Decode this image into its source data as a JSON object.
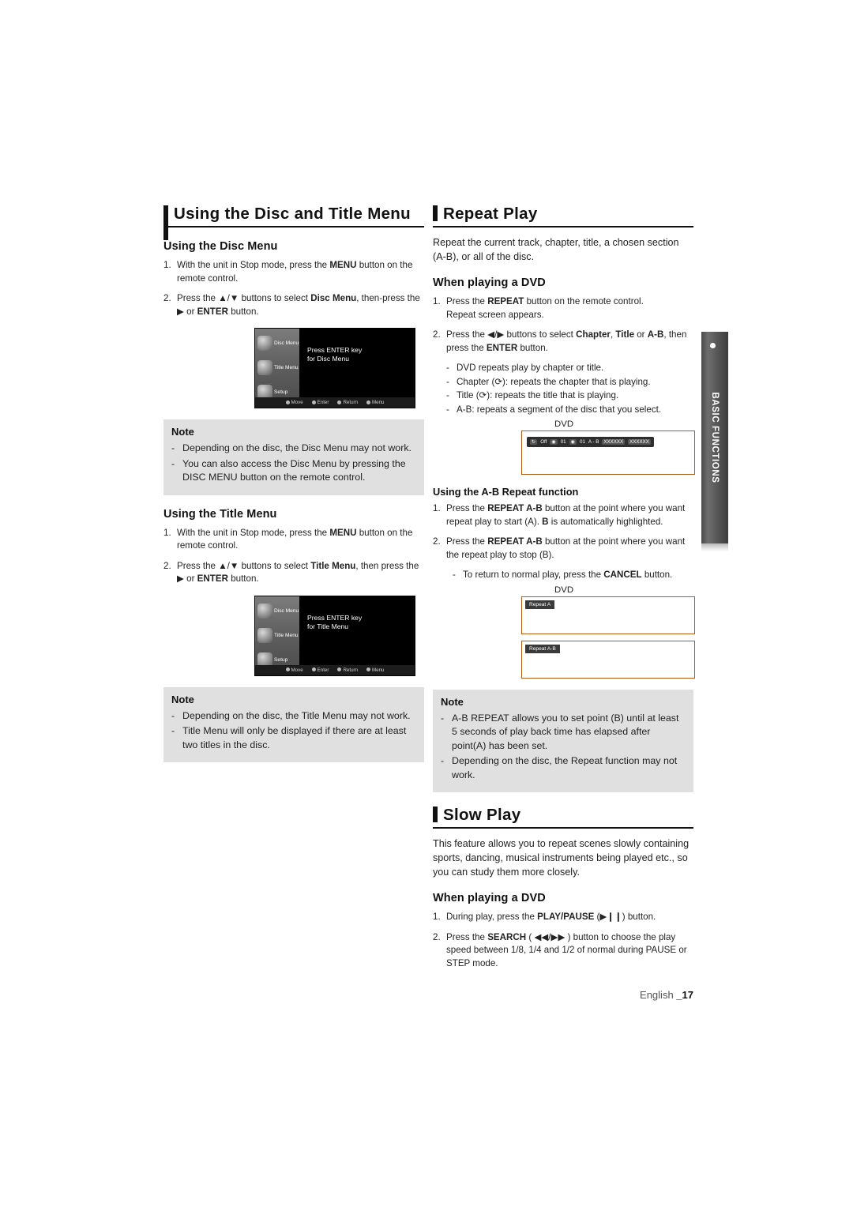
{
  "left": {
    "title": "Using the Disc and Title Menu",
    "disc_menu": {
      "heading": "Using the Disc Menu",
      "steps": [
        {
          "num": "1.",
          "text_a": "With the unit in Stop mode, press the ",
          "bold": "MENU",
          "text_b": " button on the remote control."
        },
        {
          "num": "2.",
          "text_a": "Press the ▲/▼ buttons to select ",
          "bold": "Disc Menu",
          "text_b": ", then-press the ▶ or ",
          "bold2": "ENTER",
          "text_c": " button."
        }
      ],
      "screen": {
        "items": [
          {
            "label": "Disc Menu"
          },
          {
            "label": "Title Menu"
          },
          {
            "label": "Setup"
          }
        ],
        "main_line1": "Press ENTER key",
        "main_line2": "for Disc Menu",
        "foot": [
          "Move",
          "Enter",
          "Return",
          "Menu"
        ]
      },
      "note": {
        "title": "Note",
        "items": [
          "Depending on the disc, the Disc Menu may not work.",
          "You can also access the Disc Menu by pressing the DISC MENU button on the remote control."
        ]
      }
    },
    "title_menu": {
      "heading": "Using the Title Menu",
      "steps": [
        {
          "num": "1.",
          "text_a": "With the unit in Stop mode, press the ",
          "bold": "MENU",
          "text_b": " button on the remote control."
        },
        {
          "num": "2.",
          "text_a": "Press the ▲/▼ buttons to select ",
          "bold": "Title Menu",
          "text_b": ", then press the ▶ or ",
          "bold2": "ENTER",
          "text_c": " button."
        }
      ],
      "screen": {
        "items": [
          {
            "label": "Disc Menu"
          },
          {
            "label": "Title Menu"
          },
          {
            "label": "Setup"
          }
        ],
        "main_line1": "Press ENTER key",
        "main_line2": "for Title Menu",
        "foot": [
          "Move",
          "Enter",
          "Return",
          "Menu"
        ]
      },
      "note": {
        "title": "Note",
        "items": [
          "Depending on the disc, the Title Menu may not work.",
          "Title Menu will only be displayed if there are at least two titles in the disc."
        ]
      }
    }
  },
  "right": {
    "repeat": {
      "title": "Repeat Play",
      "intro": "Repeat the current track, chapter, title, a chosen section (A-B), or all of the disc.",
      "dvd_heading": "When playing a DVD",
      "step1_a": "Press the ",
      "step1_bold": "REPEAT",
      "step1_b": " button on the remote control.",
      "step1_sub": "Repeat screen appears.",
      "step2_a": "Press the ◀/▶ buttons to select ",
      "step2_bold1": "Chapter",
      "step2_mid1": ", ",
      "step2_bold2": "Title",
      "step2_mid2": " or ",
      "step2_bold3": "A-B",
      "step2_b": ", then press the ",
      "step2_bold4": "ENTER",
      "step2_c": " button.",
      "bullets": [
        "DVD repeats play by chapter or title.",
        "Chapter (⟳): repeats the chapter that is playing.",
        "Title (⟳): repeats the title that is playing.",
        "A-B: repeats a segment of the disc that you select."
      ],
      "osd_label": "DVD",
      "osd_items": [
        "Off",
        "01",
        "01",
        "A - B",
        "XXXXXX",
        "XXXXXX"
      ],
      "ab": {
        "heading": "Using the A-B Repeat function",
        "step1_a": "Press the ",
        "step1_bold": "REPEAT A-B",
        "step1_b": " button at the point where you want repeat play to start (A). ",
        "step1_bold2": "B",
        "step1_c": " is automatically highlighted.",
        "step2_a": "Press the ",
        "step2_bold": "REPEAT A-B",
        "step2_b": " button at the point where you want the repeat play to stop (B).",
        "dash_a": "To return to normal play, press the ",
        "dash_bold": "CANCEL",
        "dash_b": " button.",
        "dvd_label": "DVD",
        "tag1": "Repeat A",
        "tag2": "Repeat A-B"
      },
      "note": {
        "title": "Note",
        "items": [
          "A-B REPEAT allows you to set point (B) until at least 5 seconds of play back time has elapsed after point(A) has been set.",
          "Depending on the disc, the Repeat function may not work."
        ]
      }
    },
    "slow": {
      "title": "Slow Play",
      "intro": "This feature allows you  to repeat scenes slowly containing sports, dancing, musical instruments being played etc., so you can study them more closely.",
      "dvd_heading": "When playing a DVD",
      "step1_a": "During play, press the ",
      "step1_bold": "PLAY/PAUSE",
      "step1_b": " (▶❙❙) button.",
      "step2_a": "Press the ",
      "step2_bold": "SEARCH",
      "step2_b": " ( ◀◀/▶▶ ) button to choose the play speed between 1/8, 1/4 and 1/2 of normal during PAUSE or STEP mode."
    }
  },
  "sidetab": {
    "label": "BASIC FUNCTIONS"
  },
  "footer": {
    "lang": "English",
    "page": "_17"
  }
}
